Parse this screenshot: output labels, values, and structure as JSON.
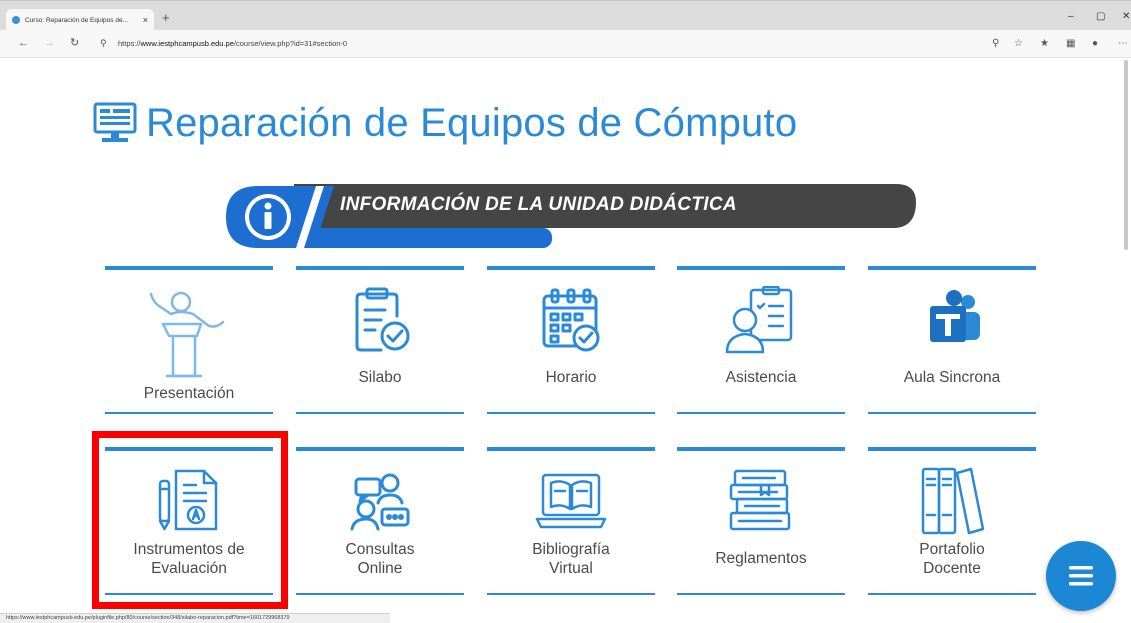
{
  "browser": {
    "tab_title": "Curso: Reparación de Equipos de...",
    "tab_close": "×",
    "new_tab": "+",
    "url_prefix": "https://",
    "url_host": "www.iestphcampusb.edu.pe",
    "url_path": "/course/view.php?id=31#section-0",
    "window_minimize": "–",
    "window_restore": "▢",
    "window_close": "✕"
  },
  "page": {
    "title": "Reparación de Equipos de Cómputo",
    "banner": "INFORMACIÓN DE LA UNIDAD DIDÁCTICA",
    "cards_row1": [
      {
        "label": "Presentación",
        "icon": "presenter-icon"
      },
      {
        "label": "Silabo",
        "icon": "syllabus-icon"
      },
      {
        "label": "Horario",
        "icon": "calendar-icon"
      },
      {
        "label": "Asistencia",
        "icon": "attendance-icon"
      },
      {
        "label": "Aula Sincrona",
        "icon": "teams-icon"
      }
    ],
    "cards_row2": [
      {
        "label": "Instrumentos de Evaluación",
        "icon": "evaluation-icon"
      },
      {
        "label": "Consultas Online",
        "icon": "chat-users-icon"
      },
      {
        "label": "Bibliografía Virtual",
        "icon": "digital-book-icon"
      },
      {
        "label": "Reglamentos",
        "icon": "books-stack-icon"
      },
      {
        "label": "Portafolio Docente",
        "icon": "binders-icon"
      }
    ]
  },
  "colors": {
    "accent": "#2a8ad6",
    "banner_dark": "#444444",
    "highlight": "#ff0000"
  },
  "statusbar": {
    "link": "https://www.iestphcampusb.edu.pe/pluginfile.php/80/course/section/348/silabo-reparacion.pdf?time=1601729968379"
  }
}
